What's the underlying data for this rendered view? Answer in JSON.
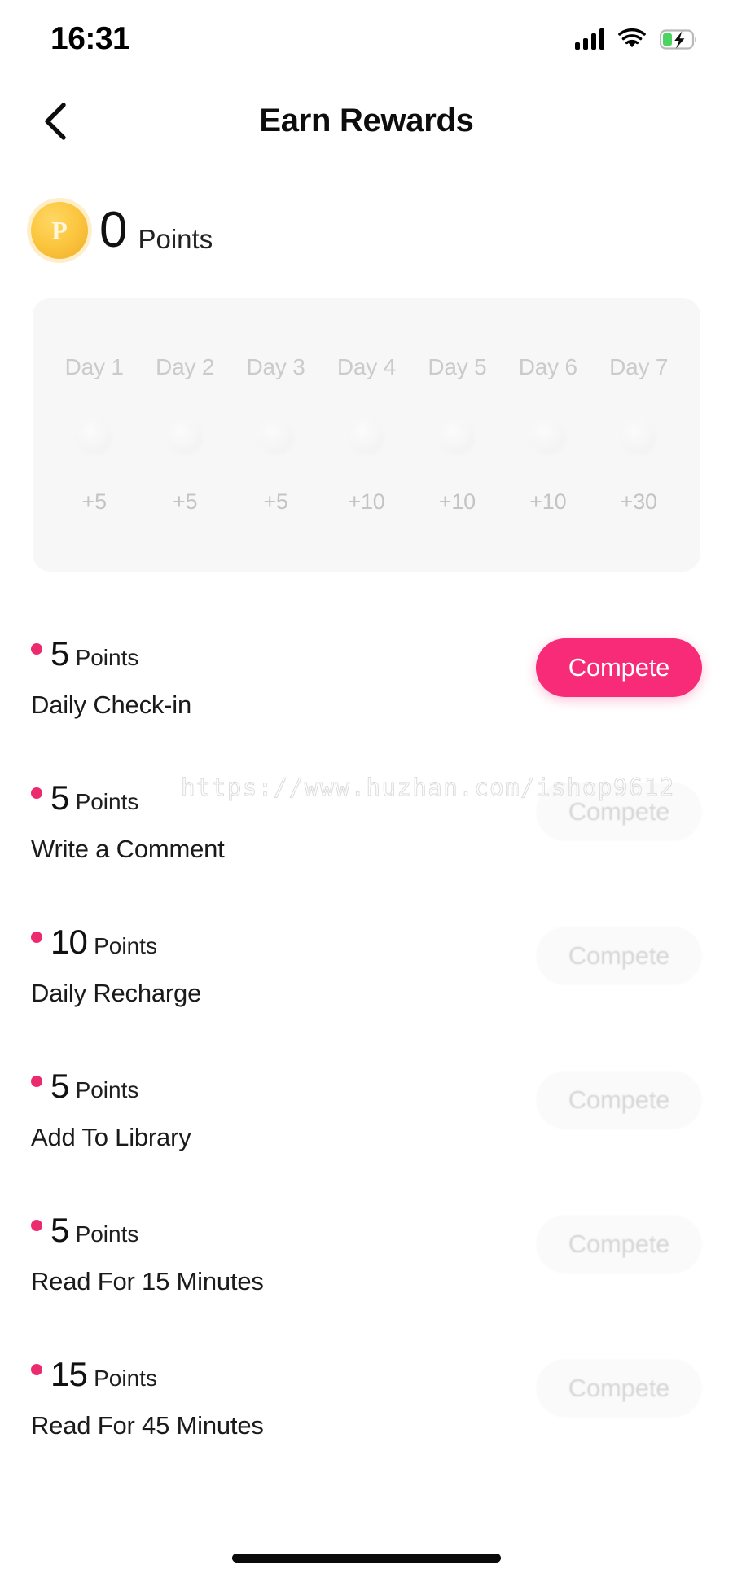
{
  "status_bar": {
    "time": "16:31",
    "icons": {
      "signal": "signal-bars-icon",
      "wifi": "wifi-icon",
      "battery": "battery-charging-icon"
    },
    "battery_color": "#4cd461"
  },
  "nav": {
    "back_icon": "chevron-left-icon",
    "title": "Earn Rewards"
  },
  "points_summary": {
    "coin_letter": "P",
    "value": "0",
    "label": "Points",
    "coin_color": "#fcc740"
  },
  "weekly_checkin": {
    "days": [
      {
        "label": "Day 1",
        "value": "+5"
      },
      {
        "label": "Day 2",
        "value": "+5"
      },
      {
        "label": "Day 3",
        "value": "+5"
      },
      {
        "label": "Day 4",
        "value": "+10"
      },
      {
        "label": "Day 5",
        "value": "+10"
      },
      {
        "label": "Day 6",
        "value": "+10"
      },
      {
        "label": "Day 7",
        "value": "+30"
      }
    ]
  },
  "tasks": [
    {
      "amount": "5",
      "points_word": "Points",
      "name": "Daily Check-in",
      "button_label": "Compete",
      "button_state": "active"
    },
    {
      "amount": "5",
      "points_word": "Points",
      "name": "Write a Comment",
      "button_label": "Compete",
      "button_state": "faded"
    },
    {
      "amount": "10",
      "points_word": "Points",
      "name": "Daily Recharge",
      "button_label": "Compete",
      "button_state": "faded"
    },
    {
      "amount": "5",
      "points_word": "Points",
      "name": "Add To Library",
      "button_label": "Compete",
      "button_state": "faded"
    },
    {
      "amount": "5",
      "points_word": "Points",
      "name": "Read For 15 Minutes",
      "button_label": "Compete",
      "button_state": "faded"
    },
    {
      "amount": "15",
      "points_word": "Points",
      "name": "Read For 45 Minutes",
      "button_label": "Compete",
      "button_state": "faded"
    }
  ],
  "watermark": {
    "text": "https://www.huzhan.com/ishop9612"
  },
  "accent_color": "#f72b77",
  "dot_color": "#ec2a6e"
}
